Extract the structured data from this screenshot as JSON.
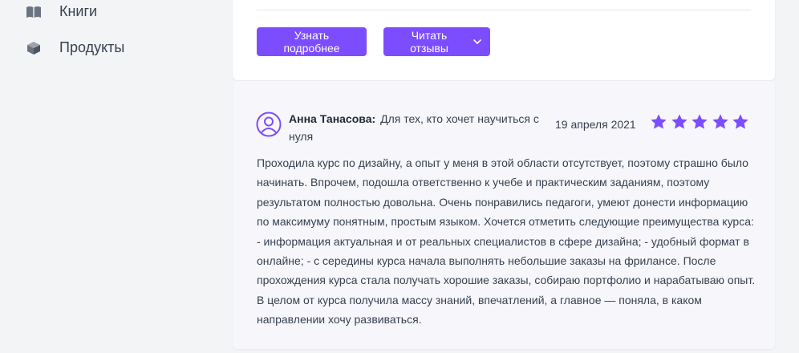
{
  "sidebar": {
    "items": [
      {
        "label": "Книги",
        "icon": "book-icon"
      },
      {
        "label": "Продукты",
        "icon": "box-icon"
      }
    ]
  },
  "course": {
    "more_label": "Узнать подробнее",
    "reviews_label": "Читать отзывы"
  },
  "review": {
    "author": "Анна Танасова:",
    "headline": "Для тех, кто хочет научиться с нуля",
    "date": "19 апреля 2021",
    "rating": 5,
    "rating_max": 5,
    "text": "Проходила курс по дизайну, а опыт у меня в этой области отсутствует, поэтому страшно было начинать. Впрочем, подошла ответственно к учебе и практическим заданиям, поэтому результатом полностью довольна. Очень понравились педагоги, умеют донести информацию по максимуму понятным, простым языком. Хочется отметить следующие преимущества курса: - информация актуальная и от реальных специалистов в сфере дизайна; - удобный формат в онлайне; - с середины курса начала выполнять небольшие заказы на фрилансе. После прохождения курса стала получать хорошие заказы, собираю портфолио и нарабатываю опыт. В целом от курса получила массу знаний, впечатлений, а главное — поняла, в каком направлении хочу развиваться."
  },
  "colors": {
    "accent": "#7c4dff",
    "page_bg": "#f3f4f6",
    "card_bg": "#ffffff",
    "review_bg": "#f7f7fb"
  }
}
